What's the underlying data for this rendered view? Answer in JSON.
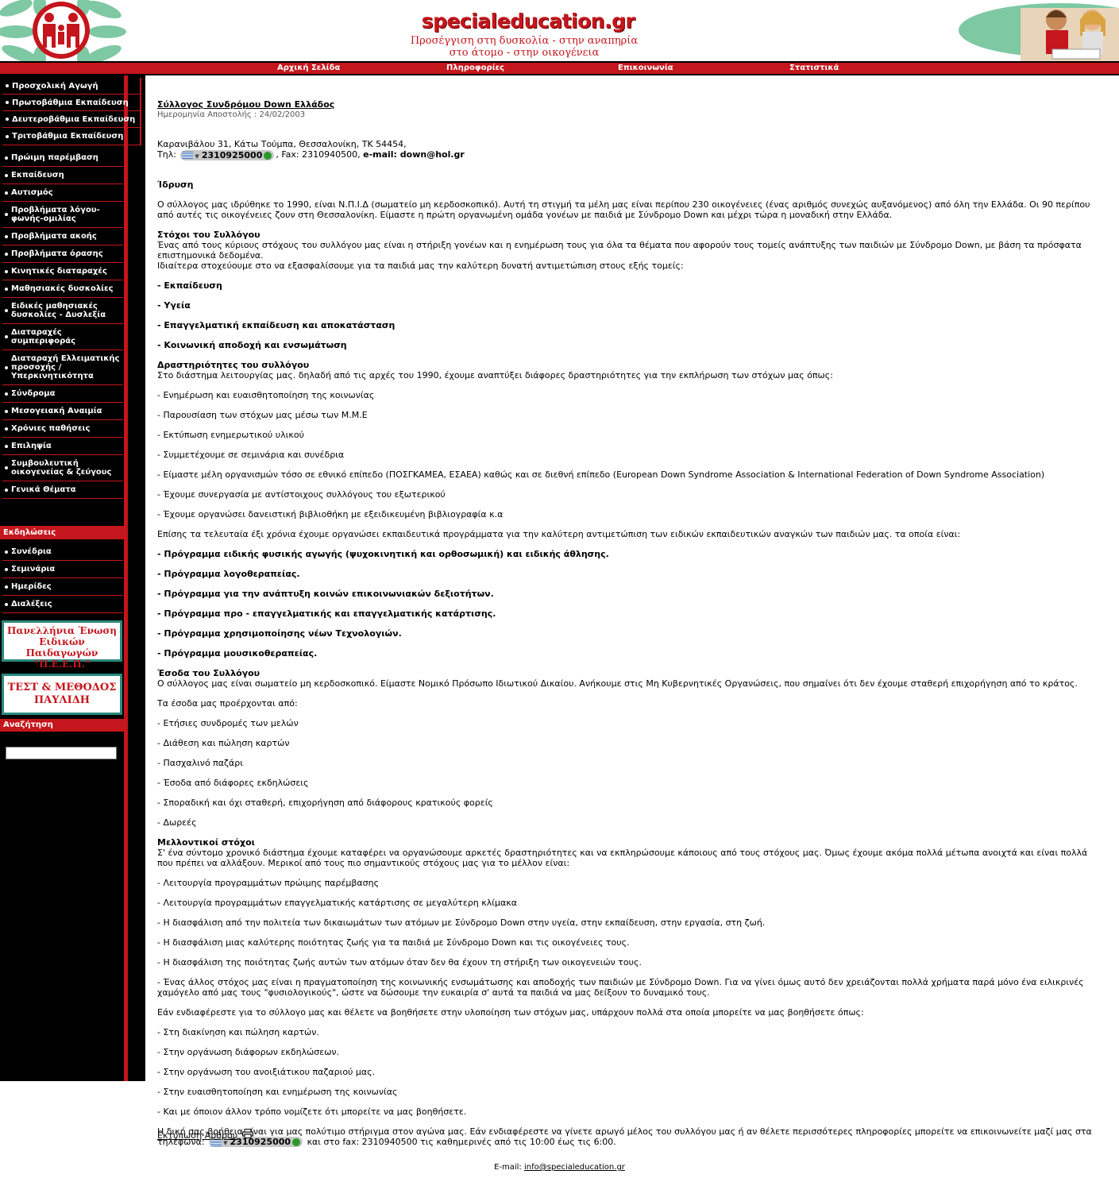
{
  "header": {
    "site_title": "specialeducation.gr",
    "tagline_line1": "Προσέγγιση στη δυσκολία - στην αναπηρία",
    "tagline_line2": "στο άτομο - στην οικογένεια"
  },
  "nav": {
    "items": [
      "Αρχική Σελίδα",
      "Πληροφορίες",
      "Επικοινωνία",
      "Στατιστικά"
    ]
  },
  "sidebar": {
    "sub_items": [
      "Προσχολική Αγωγή",
      "Πρωτοβάθμια Εκπαίδευση",
      "Δευτεροβάθμια Εκπαίδευση",
      "Τριτοβάθμια Εκπαίδευση"
    ],
    "items": [
      "Πρώιμη παρέμβαση",
      "Εκπαίδευση",
      "Αυτισμός",
      "Προβλήματα λόγου-φωνής-ομιλίας",
      "Προβλήματα ακοής",
      "Προβλήματα όρασης",
      "Κινητικές διαταραχές",
      "Μαθησιακές δυσκολίες",
      "Ειδικές μαθησιακές δυσκολίες - Δυσλεξία",
      "Διαταραχές συμπεριφοράς",
      "Διαταραχή Ελλειματικής προσοχής / Υπερκινητικότητα",
      "Σύνδρομα",
      "Μεσογειακή Αναιμία",
      "Χρόνιες παθήσεις",
      "Επιληψία",
      "Συμβουλευτική οικογενείας & ζεύγους",
      "Γενικά Θέματα"
    ],
    "events_title": "Εκδηλώσεις",
    "events": [
      "Συνέδρια",
      "Σεμινάρια",
      "Ημερίδες",
      "Διαλέξεις"
    ],
    "banner1": "Πανελλήνια Ένωση Ειδικών Παιδαγωγών \"Π.Ε.Ε.Π.\"",
    "banner2": "ΤΕΣΤ & ΜΕΘΟΔΟΣ ΠΑΥΛΙΔΗ",
    "search_title": "Αναζήτηση",
    "search_value": ""
  },
  "article": {
    "title": "Σύλλογος Συνδρόμου Down Ελλάδος",
    "date": "Ημερομηνία Αποστολής : 24/02/2003",
    "address": "Καρανιβάλου 31, Κάτω Τούμπα, Θεσσαλονίκη, ΤΚ 54454,",
    "tel_label": "Τηλ:",
    "phone": "2310925000",
    "fax_text": ", Fax: 2310940500,",
    "email_text": "e-mail: down@hol.gr",
    "h_idrysi": "Ίδρυση",
    "p_idrysi": "Ο σύλλογος μας ιδρύθηκε το 1990, είναι Ν.Π.Ι.Δ (σωματείο μη κερδοσκοπικό). Αυτή τη στιγμή τα μέλη μας είναι περίπου 230 οικογένειες (ένας αριθμός συνεχώς αυξανόμενος) από όλη την Ελλάδα. Οι 90 περίπου από αυτές τις οικογένειες ζουν στη Θεσσαλονίκη. Είμαστε η πρώτη οργανωμένη ομάδα γονέων με παιδιά με Σύνδρομο Down και μέχρι τώρα η μοναδική στην Ελλάδα.",
    "h_stoxoi": "Στόχοι του Συλλόγου",
    "p_stoxoi1": "Ένας από τους κύριους στόχους του συλλόγου μας είναι η στήριξη γονέων και η ενημέρωση τους για όλα τα θέματα που αφορούν τους τομείς ανάπτυξης των παιδιών με Σύνδρομο Down, με βάση τα πρόσφατα επιστημονικά δεδομένα.",
    "p_stoxoi2": "Ιδιαίτερα στοχεύουμε στο να εξασφαλίσουμε για τα παιδιά μας την καλύτερη δυνατή αντιμετώπιση στους εξής τομείς:",
    "domains": [
      "- Εκπαίδευση",
      "- Υγεία",
      "- Επαγγελματική εκπαίδευση και αποκατάσταση",
      "- Κοινωνική αποδοχή και ενσωμάτωση"
    ],
    "h_drast": "Δραστηριότητες του συλλόγου",
    "p_drast": "Στο διάστημα λειτουργίας μας. δηλαδή από τις αρχές του 1990, έχουμε αναπτύξει διάφορες δραστηριότητες για την εκπλήρωση των στόχων μας όπως:",
    "activities": [
      "- Ενημέρωση και ευαισθητοποίηση της κοινωνίας",
      "- Παρουσίαση των στόχων μας μέσω των Μ.Μ.Ε",
      "- Εκτύπωση ενημερωτικού υλικού",
      "- Συμμετέχουμε σε σεμινάρια και συνέδρια",
      "- Είμαστε μέλη οργανισμών τόσο σε εθνικό επίπεδο (ΠΟΣΓΚΑΜΕΑ, ΕΣΑΕΑ) καθώς και σε διεθνή επίπεδο (European Down Syndrome Association & International Federation of Down Syndrome Association)",
      "- Έχουμε συνεργασία με αντίστοιχους συλλόγους του εξωτερικού",
      "- Έχουμε οργανώσει δανειστική βιβλιοθήκη με εξειδικευμένη βιβλιογραφία κ.α"
    ],
    "p_programs": "Επίσης τα τελευταία έξι χρόνια έχουμε οργανώσει εκπαιδευτικά προγράμματα για την καλύτερη αντιμετώπιση των ειδικών εκπαιδευτικών αναγκών των παιδιών μας. τα οποία είναι:",
    "programs": [
      "- Πρόγραμμα ειδικής φυσικής αγωγής (ψυχοκινητική και ορθοσωμική) και ειδικής άθλησης.",
      "- Πρόγραμμα λογοθεραπείας.",
      "- Πρόγραμμα για την ανάπτυξη κοινών επικοινωνιακών δεξιοτήτων.",
      "- Πρόγραμμα προ - επαγγελματικής και επαγγελματικής κατάρτισης.",
      "- Πρόγραμμα χρησιμοποίησης νέων Τεχνολογιών.",
      "- Πρόγραμμα μουσικοθεραπείας."
    ],
    "h_esoda": "Έσοδα του Συλλόγου",
    "p_esoda": "Ο σύλλογος μας είναι σωματείο μη κερδοσκοπικό. Είμαστε Νομικό Πρόσωπο Ιδιωτικού Δικαίου. Ανήκουμε στις Μη Κυβερνητικές Οργανώσεις, που σημαίνει ότι δεν έχουμε σταθερή επιχορήγηση από το κράτος.",
    "p_esoda2": "Τα έσοδα μας προέρχονται από:",
    "income": [
      "- Ετήσιες συνδρομές των μελών",
      "- Διάθεση και πώληση καρτών",
      "- Πασχαλινό παζάρι",
      "- Έσοδα από διάφορες εκδηλώσεις",
      "- Σποραδική και όχι σταθερή, επιχορήγηση από διάφορους κρατικούς φορείς",
      "- Δωρεές"
    ],
    "h_future": "Μελλοντικοί στόχοι",
    "p_future": "Σ' ένα σύντομο χρονικό διάστημα έχουμε καταφέρει να οργανώσουμε αρκετές δραστηριότητες και να εκπληρώσουμε κάποιους από τους στόχους μας. Όμως έχουμε ακόμα πολλά μέτωπα ανοιχτά και είναι πολλά που πρέπει να αλλάξουν. Μερικοί από τους πιο σημαντικούς στόχους μας για το μέλλον είναι:",
    "future": [
      "- Λειτουργία προγραμμάτων πρώιμης παρέμβασης",
      "- Λειτουργία προγραμμάτων επαγγελματικής κατάρτισης σε μεγαλύτερη κλίμακα",
      "- Η διασφάλιση από την πολιτεία των δικαιωμάτων των ατόμων με Σύνδρομο Down στην υγεία, στην εκπαίδευση, στην εργασία, στη ζωή.",
      "- Η διασφάλιση μιας καλύτερης ποιότητας ζωής για τα παιδιά με Σύνδρομο Down και τις οικογένειες τους.",
      "- Η διασφάλιση της ποιότητας ζωής αυτών των ατόμων όταν δεν θα έχουν τη στήριξη των οικογενειών τους.",
      "- Ένας άλλος στόχος μας είναι η πραγματοποίηση της κοινωνικής ενσωμάτωσης και αποδοχής των παιδιών με Σύνδρομο Down. Για να γίνει όμως αυτό δεν χρειάζονται πολλά χρήματα παρά μόνο ένα ειλικρινές χαμόγελο από μας τους \"φυσιολογικούς\", ώστε να δώσουμε την ευκαιρία σ' αυτά τα παιδιά να μας δείξουν το δυναμικό τους."
    ],
    "p_help": "Εάν ενδιαφέρεστε για το σύλλογο μας και θέλετε να βοηθήσετε στην υλοποίηση των στόχων μας, υπάρχουν πολλά στα οποία μπορείτε να μας βοηθήσετε όπως:",
    "help": [
      "- Στη διακίνηση και πώληση καρτών.",
      "- Στην οργάνωση διάφορων εκδηλώσεων.",
      "- Στην οργάνωση του ανοιξιάτικου παζαριού μας.",
      "- Στην ευαισθητοποίηση και ενημέρωση της κοινωνίας",
      "- Και με όποιον άλλον τρόπο νομίζετε ότι μπορείτε να μας βοηθήσετε."
    ],
    "p_final1": "Η δική σας βοήθεια είναι για μας πολύτιμο στήριγμα στον αγώνα μας. Εάν ενδιαφέρεστε να γίνετε αρωγό μέλος του συλλόγου μας ή αν θέλετε περισσότερες πληροφορίες μπορείτε να επικοινωνείτε μαζί μας στα τηλέφωνα:",
    "p_final2": "και στο fax: 2310940500 τις καθημερινές από τις 10:00 έως τις 6:00.",
    "print_label": "Εκτύπωση Άρθρου"
  },
  "footer": {
    "label": "E-mail:",
    "email": "info@specialeducation.gr"
  },
  "colors": {
    "brand_red": "#c4161c",
    "sidebar_bg": "#000000",
    "banner_border": "#2a8a7e"
  }
}
